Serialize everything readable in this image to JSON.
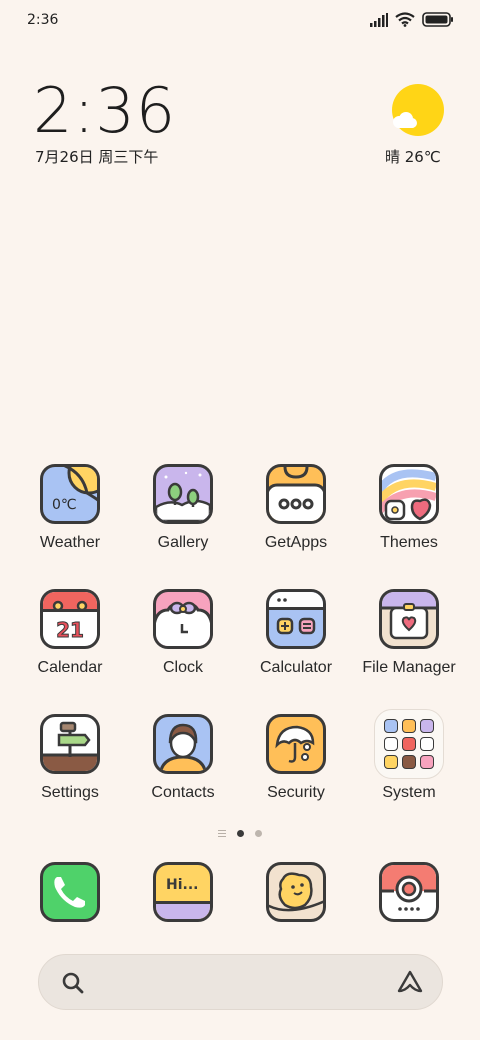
{
  "status_bar": {
    "time": "2:36"
  },
  "clock": {
    "time": "2:36",
    "date": "7月26日 周三下午"
  },
  "weather": {
    "text": "晴 26℃"
  },
  "apps": {
    "weather": {
      "label": "Weather",
      "icon_text": "0℃"
    },
    "gallery": {
      "label": "Gallery"
    },
    "getapps": {
      "label": "GetApps"
    },
    "themes": {
      "label": "Themes"
    },
    "calendar": {
      "label": "Calendar",
      "day": "21"
    },
    "clock": {
      "label": "Clock"
    },
    "calculator": {
      "label": "Calculator"
    },
    "file_manager": {
      "label": "File Manager"
    },
    "settings": {
      "label": "Settings"
    },
    "contacts": {
      "label": "Contacts"
    },
    "security": {
      "label": "Security"
    },
    "system": {
      "label": "System"
    }
  },
  "dock": {
    "messages_icon_text": "Hi..."
  },
  "colors": {
    "background": "#fbf4ee",
    "outline": "#3a3a3a"
  }
}
